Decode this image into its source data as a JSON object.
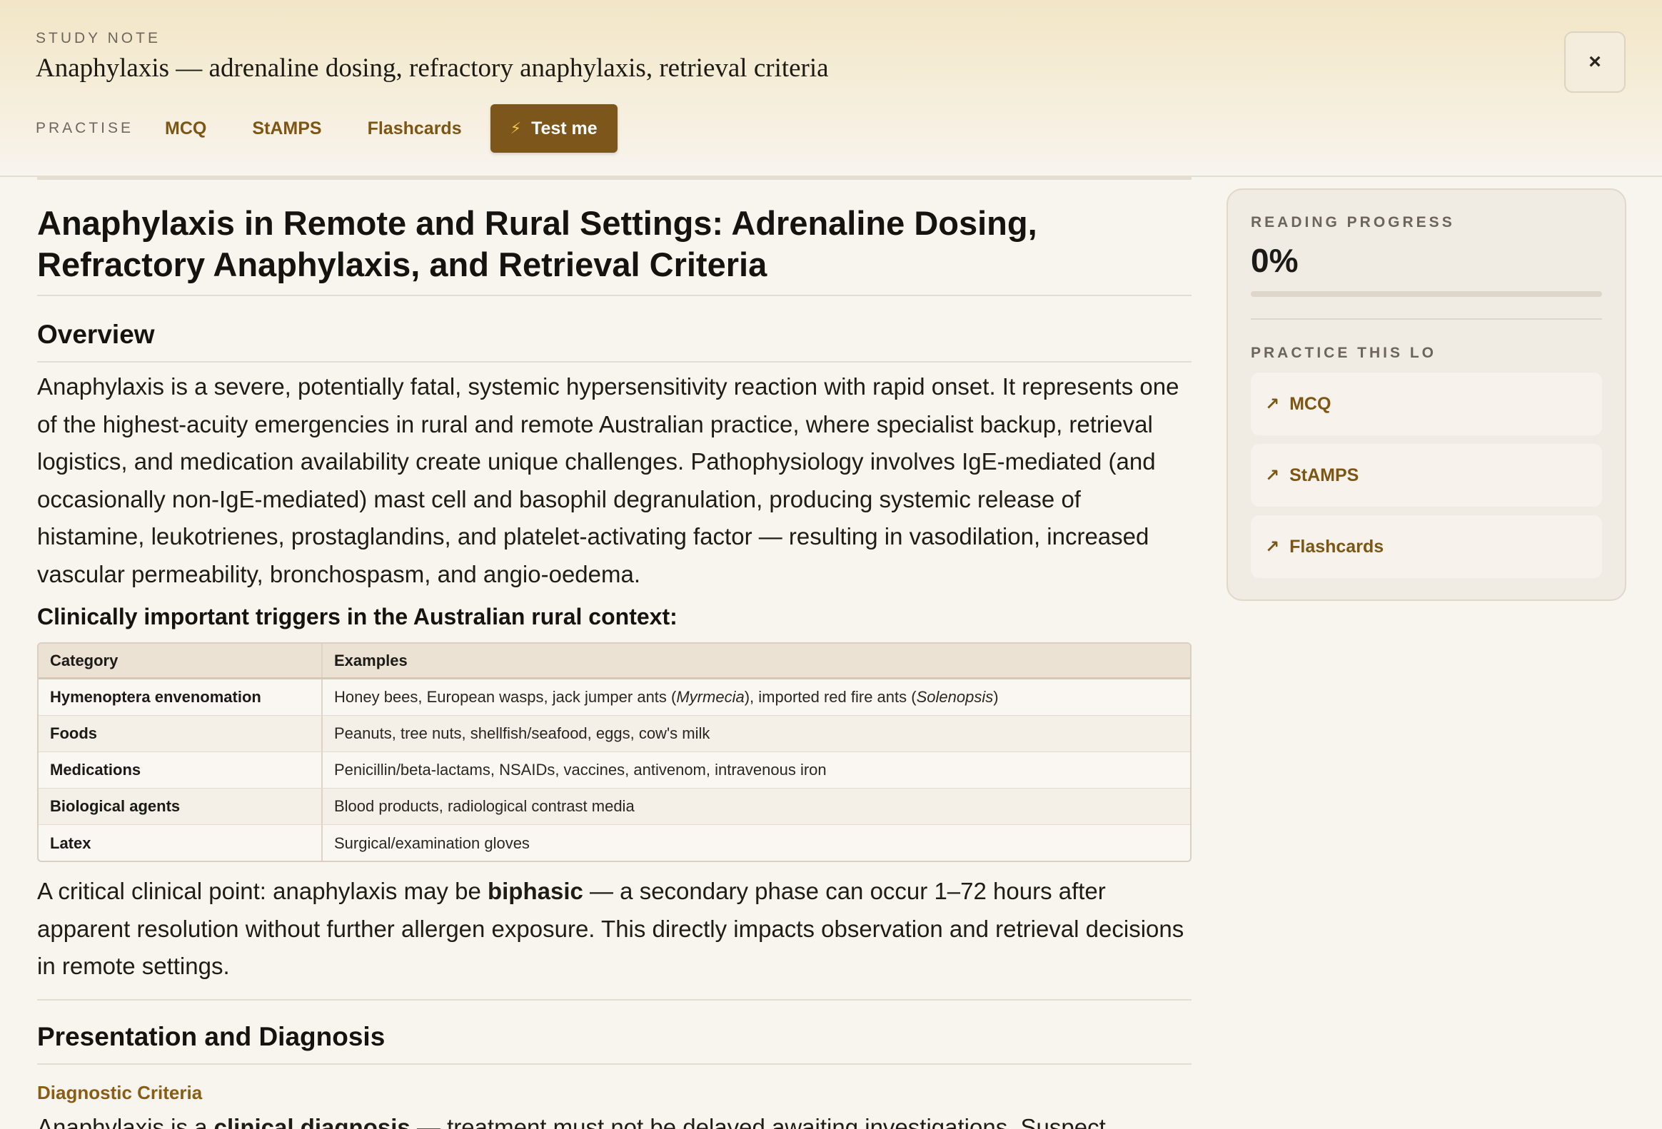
{
  "header": {
    "eyebrow": "STUDY NOTE",
    "title": "Anaphylaxis — adrenaline dosing, refractory anaphylaxis, retrieval criteria",
    "practise_label": "PRACTISE",
    "tabs": [
      "MCQ",
      "StAMPS",
      "Flashcards"
    ],
    "test_button": "Test me",
    "close_label": "×"
  },
  "article": {
    "h1": "Anaphylaxis in Remote and Rural Settings: Adrenaline Dosing, Refractory Anaphylaxis, and Retrieval Criteria",
    "overview_heading": "Overview",
    "overview_text": "Anaphylaxis is a severe, potentially fatal, systemic hypersensitivity reaction with rapid onset. It represents one of the highest-acuity emergencies in rural and remote Australian practice, where specialist backup, retrieval logistics, and medication availability create unique challenges. Pathophysiology involves IgE-mediated (and occasionally non-IgE-mediated) mast cell and basophil degranulation, producing systemic release of histamine, leukotrienes, prostaglandins, and platelet-activating factor — resulting in vasodilation, increased vascular permeability, bronchospasm, and angio-oedema.",
    "triggers_heading": "Clinically important triggers in the Australian rural context:",
    "table": {
      "headers": [
        "Category",
        "Examples"
      ],
      "rows": [
        {
          "category": "Hymenoptera envenomation",
          "ex1": "Honey bees, European wasps, jack jumper ants (",
          "ex_i1": "Myrmecia",
          "ex2": "), imported red fire ants (",
          "ex_i2": "Solenopsis",
          "ex3": ")"
        },
        {
          "category": "Foods",
          "examples": "Peanuts, tree nuts, shellfish/seafood, eggs, cow's milk"
        },
        {
          "category": "Medications",
          "examples": "Penicillin/beta-lactams, NSAIDs, vaccines, antivenom, intravenous iron"
        },
        {
          "category": "Biological agents",
          "examples": "Blood products, radiological contrast media"
        },
        {
          "category": "Latex",
          "examples": "Surgical/examination gloves"
        }
      ]
    },
    "biphasic_pre": "A critical clinical point: anaphylaxis may be ",
    "biphasic_bold": "biphasic",
    "biphasic_post": " — a secondary phase can occur 1–72 hours after apparent resolution without further allergen exposure. This directly impacts observation and retrieval decisions in remote settings.",
    "presentation_heading": "Presentation and Diagnosis",
    "diagnostic_heading": "Diagnostic Criteria",
    "diag_pre": "Anaphylaxis is a ",
    "diag_bold": "clinical diagnosis",
    "diag_post": " — treatment must not be delayed awaiting investigations. Suspect"
  },
  "sidebar": {
    "progress_label": "READING PROGRESS",
    "progress_text": "0%",
    "progress_fraction": 0,
    "practice_label": "PRACTICE THIS LO",
    "links": [
      "MCQ",
      "StAMPS",
      "Flashcards"
    ]
  }
}
